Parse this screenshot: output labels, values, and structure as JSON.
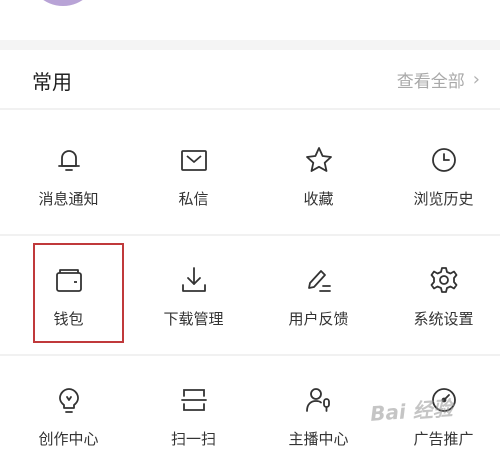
{
  "section": {
    "title": "常用",
    "view_all": "查看全部",
    "view_all_chevron": "›"
  },
  "grid": {
    "rows": [
      [
        {
          "label": "消息通知",
          "icon": "bell-icon"
        },
        {
          "label": "私信",
          "icon": "envelope-icon"
        },
        {
          "label": "收藏",
          "icon": "star-icon"
        },
        {
          "label": "浏览历史",
          "icon": "clock-icon"
        }
      ],
      [
        {
          "label": "钱包",
          "icon": "wallet-icon"
        },
        {
          "label": "下载管理",
          "icon": "download-icon"
        },
        {
          "label": "用户反馈",
          "icon": "pencil-icon"
        },
        {
          "label": "系统设置",
          "icon": "gear-icon"
        }
      ],
      [
        {
          "label": "创作中心",
          "icon": "lightbulb-icon"
        },
        {
          "label": "扫一扫",
          "icon": "scan-icon"
        },
        {
          "label": "主播中心",
          "icon": "streamer-icon"
        },
        {
          "label": "广告推广",
          "icon": "gauge-icon"
        }
      ]
    ]
  },
  "highlighted_item": "钱包",
  "watermark": "Bai 经验",
  "colors": {
    "avatar": "#b8a3d6",
    "highlight_border": "#c0393b",
    "icon_stroke": "#333333",
    "muted_text": "#a9a9a9"
  }
}
